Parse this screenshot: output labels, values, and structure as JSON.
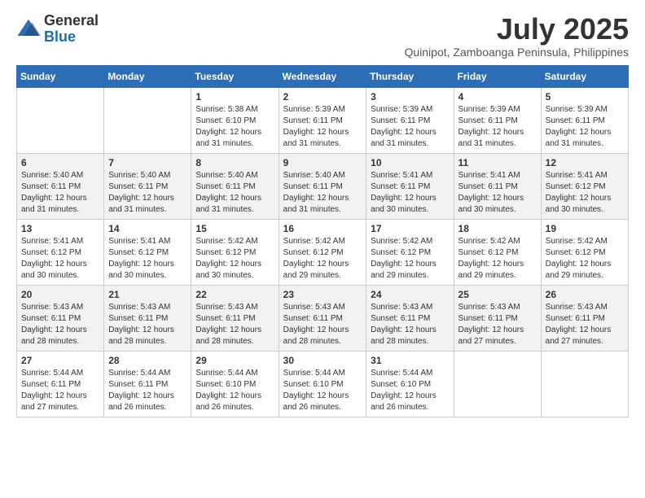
{
  "logo": {
    "text_general": "General",
    "text_blue": "Blue"
  },
  "title": "July 2025",
  "subtitle": "Quinipot, Zamboanga Peninsula, Philippines",
  "weekdays": [
    "Sunday",
    "Monday",
    "Tuesday",
    "Wednesday",
    "Thursday",
    "Friday",
    "Saturday"
  ],
  "weeks": [
    [
      {
        "day": "",
        "sunrise": "",
        "sunset": "",
        "daylight": ""
      },
      {
        "day": "",
        "sunrise": "",
        "sunset": "",
        "daylight": ""
      },
      {
        "day": "1",
        "sunrise": "Sunrise: 5:38 AM",
        "sunset": "Sunset: 6:10 PM",
        "daylight": "Daylight: 12 hours and 31 minutes."
      },
      {
        "day": "2",
        "sunrise": "Sunrise: 5:39 AM",
        "sunset": "Sunset: 6:11 PM",
        "daylight": "Daylight: 12 hours and 31 minutes."
      },
      {
        "day": "3",
        "sunrise": "Sunrise: 5:39 AM",
        "sunset": "Sunset: 6:11 PM",
        "daylight": "Daylight: 12 hours and 31 minutes."
      },
      {
        "day": "4",
        "sunrise": "Sunrise: 5:39 AM",
        "sunset": "Sunset: 6:11 PM",
        "daylight": "Daylight: 12 hours and 31 minutes."
      },
      {
        "day": "5",
        "sunrise": "Sunrise: 5:39 AM",
        "sunset": "Sunset: 6:11 PM",
        "daylight": "Daylight: 12 hours and 31 minutes."
      }
    ],
    [
      {
        "day": "6",
        "sunrise": "Sunrise: 5:40 AM",
        "sunset": "Sunset: 6:11 PM",
        "daylight": "Daylight: 12 hours and 31 minutes."
      },
      {
        "day": "7",
        "sunrise": "Sunrise: 5:40 AM",
        "sunset": "Sunset: 6:11 PM",
        "daylight": "Daylight: 12 hours and 31 minutes."
      },
      {
        "day": "8",
        "sunrise": "Sunrise: 5:40 AM",
        "sunset": "Sunset: 6:11 PM",
        "daylight": "Daylight: 12 hours and 31 minutes."
      },
      {
        "day": "9",
        "sunrise": "Sunrise: 5:40 AM",
        "sunset": "Sunset: 6:11 PM",
        "daylight": "Daylight: 12 hours and 31 minutes."
      },
      {
        "day": "10",
        "sunrise": "Sunrise: 5:41 AM",
        "sunset": "Sunset: 6:11 PM",
        "daylight": "Daylight: 12 hours and 30 minutes."
      },
      {
        "day": "11",
        "sunrise": "Sunrise: 5:41 AM",
        "sunset": "Sunset: 6:11 PM",
        "daylight": "Daylight: 12 hours and 30 minutes."
      },
      {
        "day": "12",
        "sunrise": "Sunrise: 5:41 AM",
        "sunset": "Sunset: 6:12 PM",
        "daylight": "Daylight: 12 hours and 30 minutes."
      }
    ],
    [
      {
        "day": "13",
        "sunrise": "Sunrise: 5:41 AM",
        "sunset": "Sunset: 6:12 PM",
        "daylight": "Daylight: 12 hours and 30 minutes."
      },
      {
        "day": "14",
        "sunrise": "Sunrise: 5:41 AM",
        "sunset": "Sunset: 6:12 PM",
        "daylight": "Daylight: 12 hours and 30 minutes."
      },
      {
        "day": "15",
        "sunrise": "Sunrise: 5:42 AM",
        "sunset": "Sunset: 6:12 PM",
        "daylight": "Daylight: 12 hours and 30 minutes."
      },
      {
        "day": "16",
        "sunrise": "Sunrise: 5:42 AM",
        "sunset": "Sunset: 6:12 PM",
        "daylight": "Daylight: 12 hours and 29 minutes."
      },
      {
        "day": "17",
        "sunrise": "Sunrise: 5:42 AM",
        "sunset": "Sunset: 6:12 PM",
        "daylight": "Daylight: 12 hours and 29 minutes."
      },
      {
        "day": "18",
        "sunrise": "Sunrise: 5:42 AM",
        "sunset": "Sunset: 6:12 PM",
        "daylight": "Daylight: 12 hours and 29 minutes."
      },
      {
        "day": "19",
        "sunrise": "Sunrise: 5:42 AM",
        "sunset": "Sunset: 6:12 PM",
        "daylight": "Daylight: 12 hours and 29 minutes."
      }
    ],
    [
      {
        "day": "20",
        "sunrise": "Sunrise: 5:43 AM",
        "sunset": "Sunset: 6:11 PM",
        "daylight": "Daylight: 12 hours and 28 minutes."
      },
      {
        "day": "21",
        "sunrise": "Sunrise: 5:43 AM",
        "sunset": "Sunset: 6:11 PM",
        "daylight": "Daylight: 12 hours and 28 minutes."
      },
      {
        "day": "22",
        "sunrise": "Sunrise: 5:43 AM",
        "sunset": "Sunset: 6:11 PM",
        "daylight": "Daylight: 12 hours and 28 minutes."
      },
      {
        "day": "23",
        "sunrise": "Sunrise: 5:43 AM",
        "sunset": "Sunset: 6:11 PM",
        "daylight": "Daylight: 12 hours and 28 minutes."
      },
      {
        "day": "24",
        "sunrise": "Sunrise: 5:43 AM",
        "sunset": "Sunset: 6:11 PM",
        "daylight": "Daylight: 12 hours and 28 minutes."
      },
      {
        "day": "25",
        "sunrise": "Sunrise: 5:43 AM",
        "sunset": "Sunset: 6:11 PM",
        "daylight": "Daylight: 12 hours and 27 minutes."
      },
      {
        "day": "26",
        "sunrise": "Sunrise: 5:43 AM",
        "sunset": "Sunset: 6:11 PM",
        "daylight": "Daylight: 12 hours and 27 minutes."
      }
    ],
    [
      {
        "day": "27",
        "sunrise": "Sunrise: 5:44 AM",
        "sunset": "Sunset: 6:11 PM",
        "daylight": "Daylight: 12 hours and 27 minutes."
      },
      {
        "day": "28",
        "sunrise": "Sunrise: 5:44 AM",
        "sunset": "Sunset: 6:11 PM",
        "daylight": "Daylight: 12 hours and 26 minutes."
      },
      {
        "day": "29",
        "sunrise": "Sunrise: 5:44 AM",
        "sunset": "Sunset: 6:10 PM",
        "daylight": "Daylight: 12 hours and 26 minutes."
      },
      {
        "day": "30",
        "sunrise": "Sunrise: 5:44 AM",
        "sunset": "Sunset: 6:10 PM",
        "daylight": "Daylight: 12 hours and 26 minutes."
      },
      {
        "day": "31",
        "sunrise": "Sunrise: 5:44 AM",
        "sunset": "Sunset: 6:10 PM",
        "daylight": "Daylight: 12 hours and 26 minutes."
      },
      {
        "day": "",
        "sunrise": "",
        "sunset": "",
        "daylight": ""
      },
      {
        "day": "",
        "sunrise": "",
        "sunset": "",
        "daylight": ""
      }
    ]
  ]
}
